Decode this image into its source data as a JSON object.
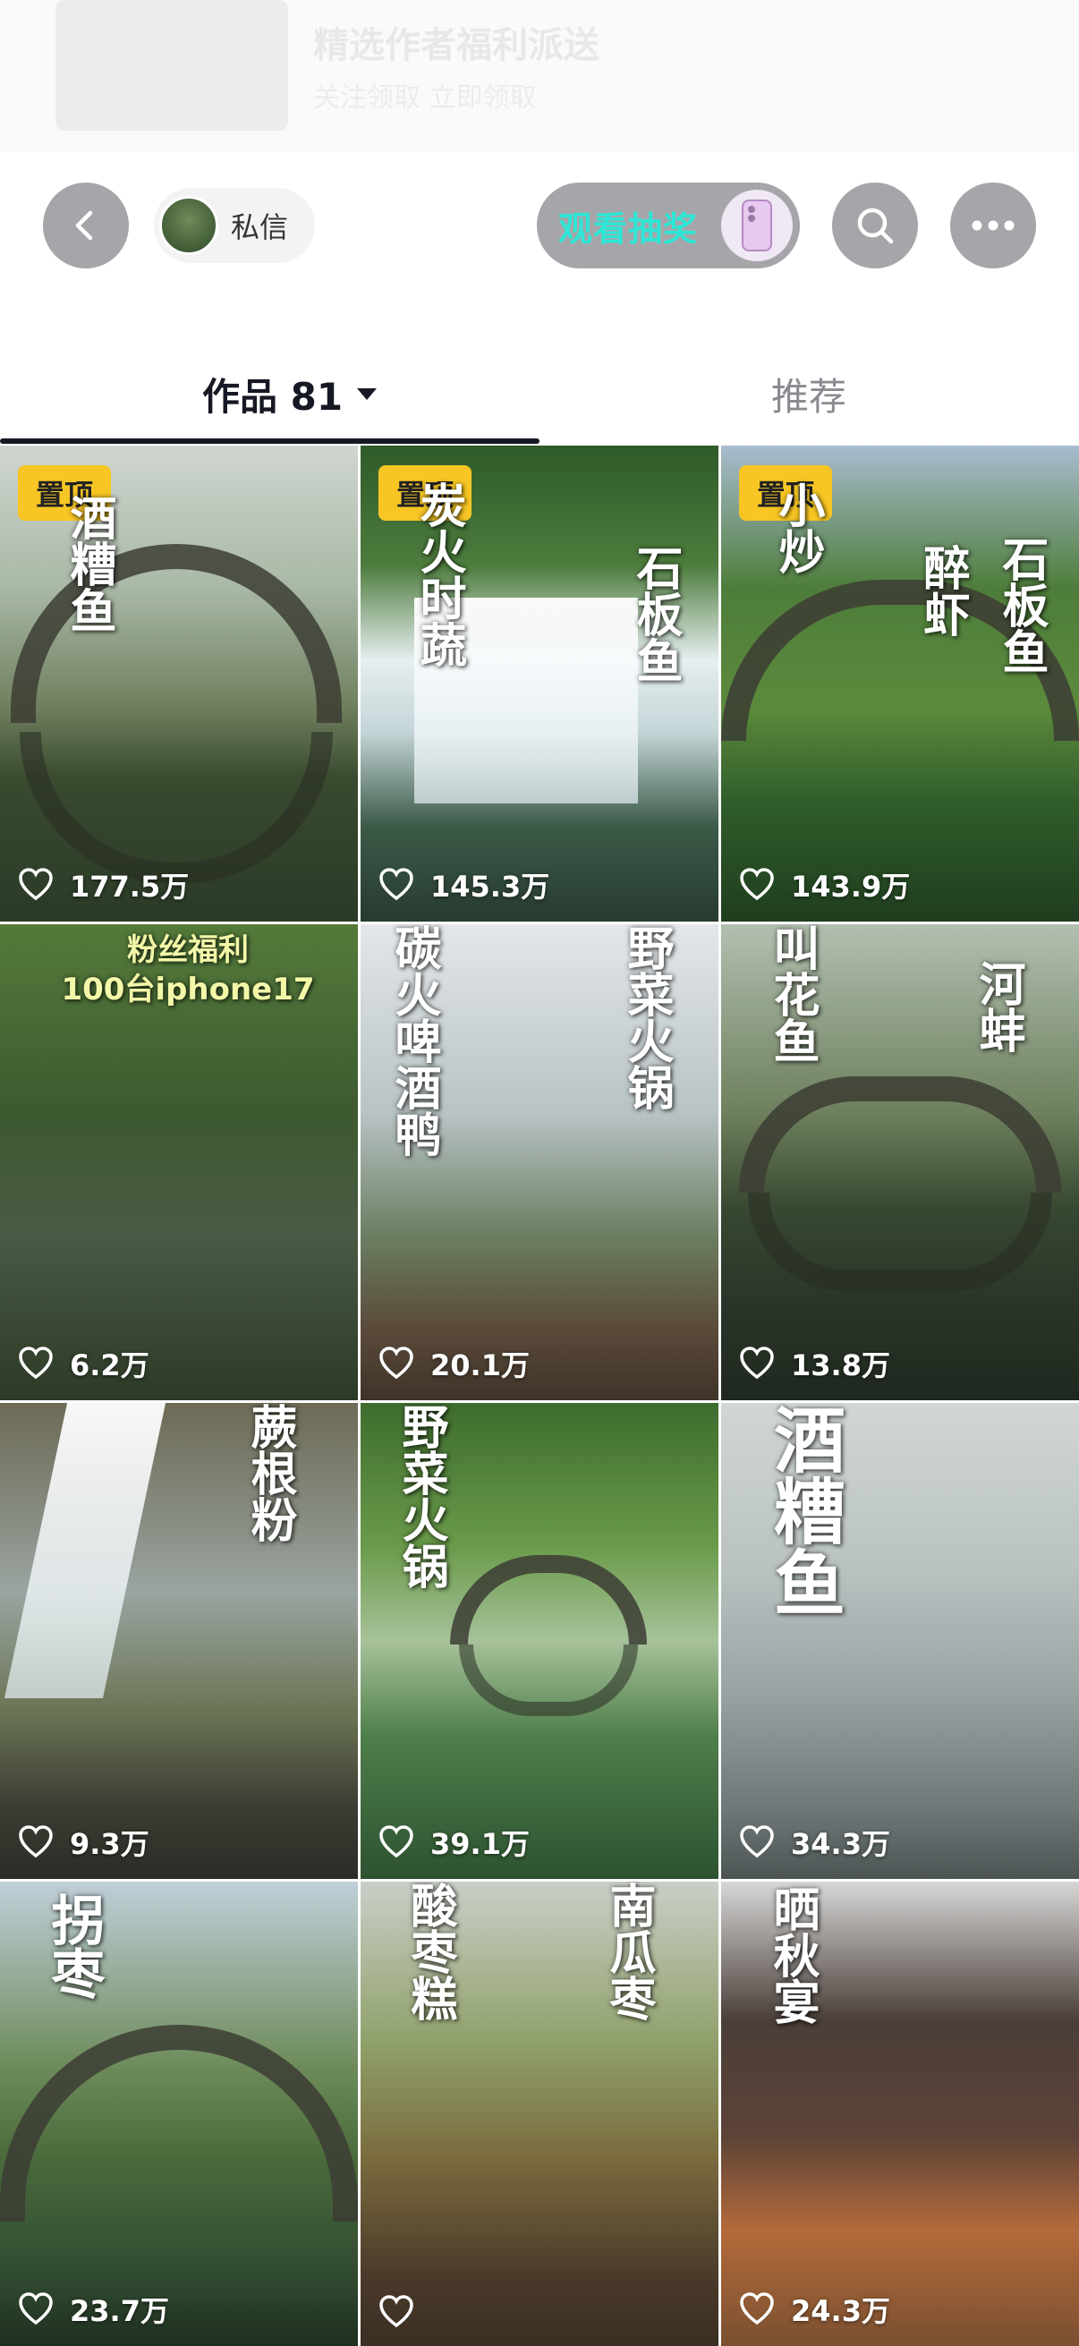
{
  "banner": {
    "title": "精选作者福利派送",
    "subtitle": "关注领取 立即领取"
  },
  "header": {
    "chat_label": "私信",
    "lottery_label": "观看抽奖"
  },
  "tabs": {
    "works_label": "作品 81",
    "recommend_label": "推荐"
  },
  "pin_label": "置顶",
  "videos": [
    {
      "captions": [
        "酒糟鱼"
      ],
      "pinned": true,
      "likes": "177.5万"
    },
    {
      "captions": [
        "炭火时蔬",
        "石板鱼"
      ],
      "pinned": true,
      "likes": "145.3万"
    },
    {
      "captions": [
        "小炒",
        "醉虾",
        "石板鱼"
      ],
      "pinned": true,
      "likes": "143.9万"
    },
    {
      "captions": [
        "粉丝福利",
        "100台iphone17"
      ],
      "pinned": false,
      "likes": "6.2万"
    },
    {
      "captions": [
        "碳火啤酒鸭",
        "野菜火锅"
      ],
      "pinned": false,
      "likes": "20.1万"
    },
    {
      "captions": [
        "叫花鱼",
        "河蚌"
      ],
      "pinned": false,
      "likes": "13.8万"
    },
    {
      "captions": [
        "蕨根粉"
      ],
      "pinned": false,
      "likes": "9.3万"
    },
    {
      "captions": [
        "野菜火锅"
      ],
      "pinned": false,
      "likes": "39.1万"
    },
    {
      "captions": [
        "酒糟鱼"
      ],
      "pinned": false,
      "likes": "34.3万"
    },
    {
      "captions": [
        "拐枣"
      ],
      "pinned": false,
      "likes": "23.7万"
    },
    {
      "captions": [
        "酸枣糕",
        "南瓜枣"
      ],
      "pinned": false,
      "likes": ""
    },
    {
      "captions": [
        "晒秋宴"
      ],
      "pinned": false,
      "likes": "24.3万"
    }
  ]
}
